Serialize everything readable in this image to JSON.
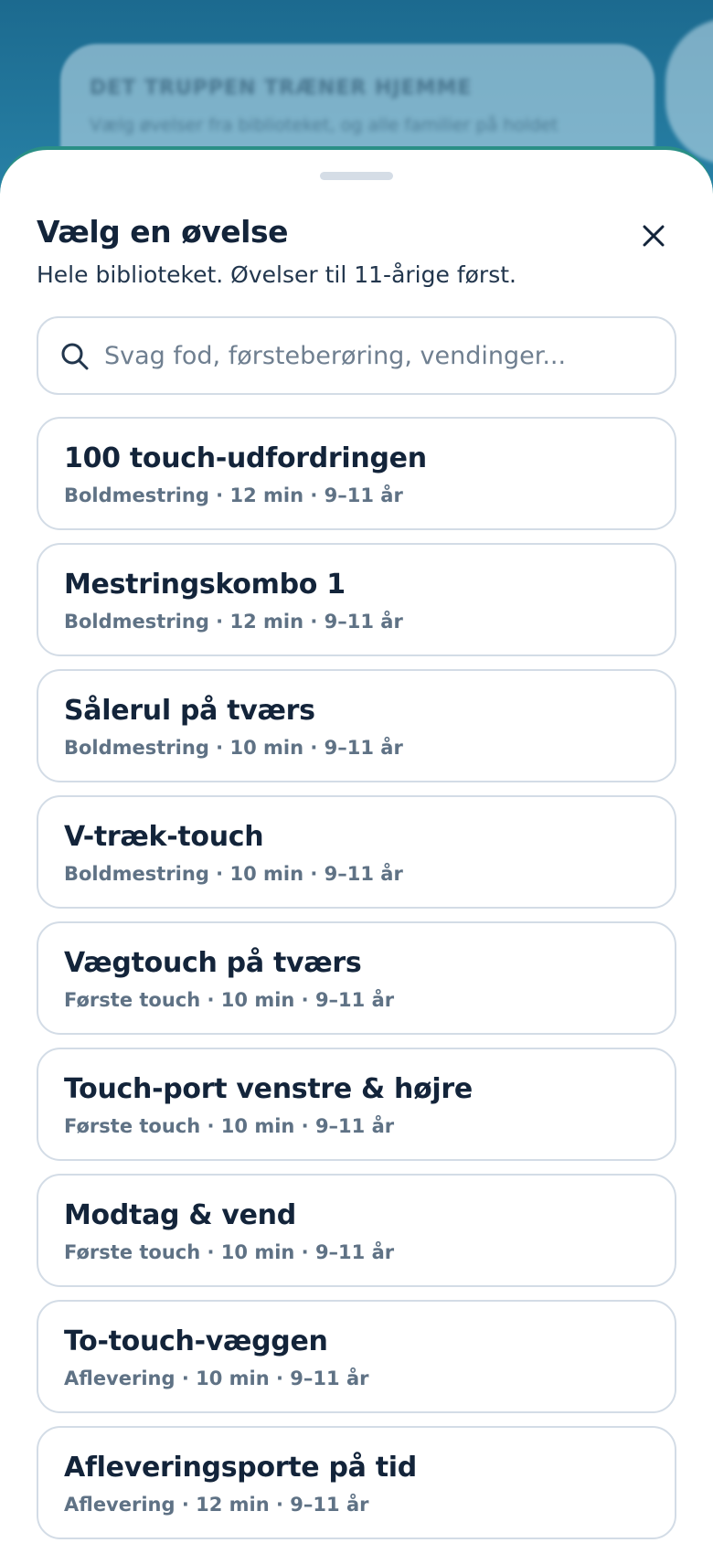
{
  "background": {
    "card_title": "DET TRUPPEN TRÆNER HJEMME",
    "card_subtitle": "Vælg øvelser fra biblioteket, og alle familier på holdet"
  },
  "sheet": {
    "title": "Vælg en øvelse",
    "subtitle": "Hele biblioteket. Øvelser til 11-årige først.",
    "close_icon": "close-icon"
  },
  "search": {
    "icon": "search-icon",
    "value": "",
    "placeholder": "Svag fod, førsteberøring, vendinger..."
  },
  "exercises": [
    {
      "title": "100 touch-udfordringen",
      "meta": "Boldmestring · 12 min · 9–11 år"
    },
    {
      "title": "Mestringskombo 1",
      "meta": "Boldmestring · 12 min · 9–11 år"
    },
    {
      "title": "Sålerul på tværs",
      "meta": "Boldmestring · 10 min · 9–11 år"
    },
    {
      "title": "V-træk-touch",
      "meta": "Boldmestring · 10 min · 9–11 år"
    },
    {
      "title": "Vægtouch på tværs",
      "meta": "Første touch · 10 min · 9–11 år"
    },
    {
      "title": "Touch-port venstre & højre",
      "meta": "Første touch · 10 min · 9–11 år"
    },
    {
      "title": "Modtag & vend",
      "meta": "Første touch · 10 min · 9–11 år"
    },
    {
      "title": "To-touch-væggen",
      "meta": "Aflevering · 10 min · 9–11 år"
    },
    {
      "title": "Afleveringsporte på tid",
      "meta": "Aflevering · 12 min · 9–11 år"
    }
  ],
  "colors": {
    "backdrop": "#1e6f94",
    "accent_border": "#2a8f86",
    "text_primary": "#13243a",
    "text_secondary": "#5f7285",
    "card_border": "#d3dce6"
  }
}
